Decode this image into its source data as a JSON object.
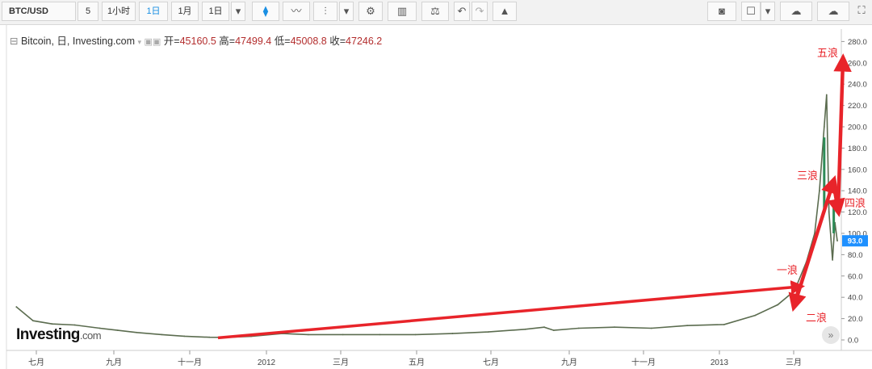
{
  "toolbar": {
    "symbol": "BTC/USD",
    "interval_5": "5",
    "interval_1h": "1小时",
    "interval_1d": "1日",
    "interval_1m": "1月",
    "range": "1日"
  },
  "legend": {
    "name": "Bitcoin, 日, Investing.com",
    "open_label": "开=",
    "open": "45160.5",
    "high_label": "高=",
    "high": "47499.4",
    "low_label": "低=",
    "low": "45008.8",
    "close_label": "收=",
    "close": "47246.2"
  },
  "logo": {
    "brand": "Investing",
    "suffix": ".com"
  },
  "colors": {
    "price_line": "#5b6c4f",
    "arrow": "#e8242a",
    "wave_label": "#e8242a",
    "price_tag": "#1e90ff"
  },
  "chart_data": {
    "type": "line",
    "xlabel": "",
    "ylabel": "",
    "x_ticks": [
      "七月",
      "九月",
      "十一月",
      "2012",
      "三月",
      "五月",
      "七月",
      "九月",
      "十一月",
      "2013",
      "三月"
    ],
    "y_ticks": [
      "0.0",
      "20.0",
      "40.0",
      "60.0",
      "80.0",
      "100.0",
      "120.0",
      "140.0",
      "160.0",
      "180.0",
      "200.0",
      "220.0",
      "240.0",
      "260.0",
      "280.0"
    ],
    "ylim": [
      0,
      290
    ],
    "x": [
      "2011-06-01",
      "2011-06-15",
      "2011-07-01",
      "2011-07-20",
      "2011-08-10",
      "2011-08-25",
      "2011-09-10",
      "2011-10-01",
      "2011-10-20",
      "2011-11-10",
      "2011-11-25",
      "2011-12-15",
      "2012-01-10",
      "2012-02-01",
      "2012-03-01",
      "2012-04-01",
      "2012-05-01",
      "2012-06-01",
      "2012-07-01",
      "2012-08-01",
      "2012-08-17",
      "2012-08-25",
      "2012-09-15",
      "2012-10-15",
      "2012-11-15",
      "2012-12-15",
      "2013-01-15",
      "2013-02-10",
      "2013-03-01",
      "2013-03-15",
      "2013-03-25",
      "2013-04-01",
      "2013-04-05",
      "2013-04-09",
      "2013-04-11",
      "2013-04-13",
      "2013-04-16",
      "2013-04-18",
      "2013-04-20"
    ],
    "series": [
      {
        "name": "",
        "values": [
          31,
          18,
          15,
          14,
          11,
          9,
          7,
          5,
          3.5,
          2.5,
          2.4,
          3.3,
          6,
          5,
          5,
          5,
          5,
          6,
          7.5,
          10,
          12,
          9,
          11,
          12,
          11,
          13.5,
          14.5,
          23,
          33,
          46,
          73,
          100,
          140,
          200,
          230,
          120,
          75,
          110,
          93
        ]
      }
    ],
    "current_price": "93.0",
    "annotations": [
      {
        "label": "一浪",
        "x": "2013-03-01",
        "y": 38
      },
      {
        "label": "二浪",
        "x": "2013-03-05",
        "y": 20
      },
      {
        "label": "三浪",
        "x": "2013-04-05",
        "y": 145
      },
      {
        "label": "四浪",
        "x": "2013-04-16",
        "y": 125
      },
      {
        "label": "五浪",
        "x": "2013-04-09",
        "y": 270
      }
    ]
  }
}
